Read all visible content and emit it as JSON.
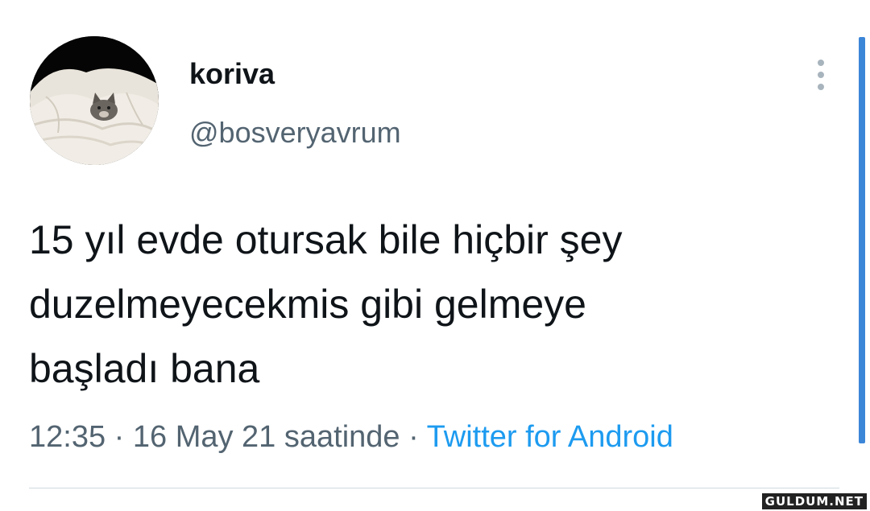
{
  "tweet": {
    "display_name": "koriva",
    "handle": "@bosveryavrum",
    "text_lines": [
      "15 yıl evde otursak bile hiçbir şey",
      "duzelmeyecekmis gibi gelmeye",
      "başladı bana"
    ],
    "time": "12:35",
    "separator": "·",
    "date_text": "16 May 21 saatinde",
    "source": "Twitter for Android"
  },
  "icons": {
    "avatar": "cat-on-blanket-avatar",
    "more": "more-vertical-icon"
  },
  "colors": {
    "text": "#0f1419",
    "secondary": "#536471",
    "link": "#1d9bf0"
  },
  "watermark": "GULDUM.NET"
}
